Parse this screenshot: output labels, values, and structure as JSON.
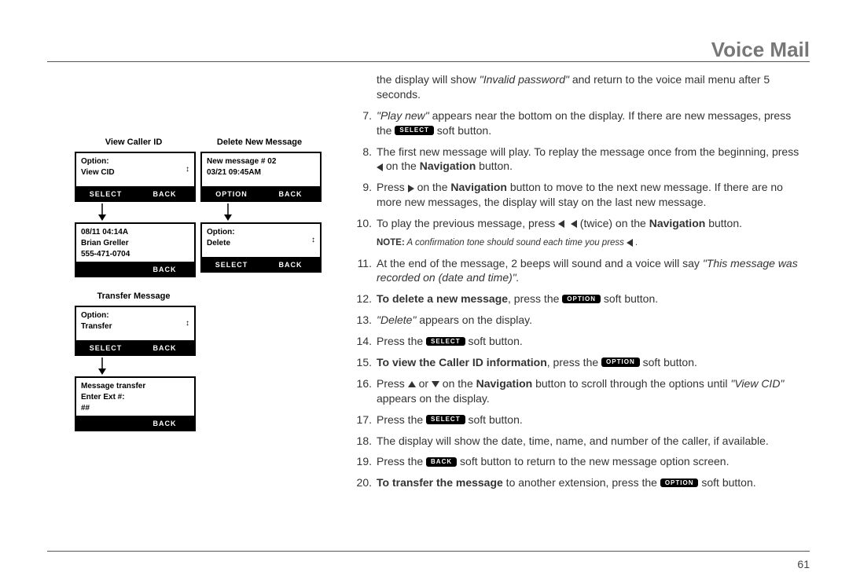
{
  "header": "Voice Mail",
  "pagenum": "61",
  "lcd": {
    "viewCid": {
      "title": "View Caller ID",
      "box1": {
        "line1": "Option:",
        "line2": "View CID",
        "softL": "SELECT",
        "softR": "BACK"
      },
      "box2": {
        "line1": "08/11 04:14A",
        "line2": "Brian Greller",
        "line3": "555-471-0704",
        "softL": "",
        "softR": "BACK"
      }
    },
    "deleteNew": {
      "title": "Delete New Message",
      "box1": {
        "line1": "New message # 02",
        "line2": "03/21 09:45AM",
        "softL": "OPTION",
        "softR": "BACK"
      },
      "box2": {
        "line1": "Option:",
        "line2": "Delete",
        "softL": "SELECT",
        "softR": "BACK"
      }
    },
    "transfer": {
      "title": "Transfer Message",
      "box1": {
        "line1": "Option:",
        "line2": "Transfer",
        "softL": "SELECT",
        "softR": "BACK"
      },
      "box2": {
        "line1": "Message transfer",
        "line2": "Enter Ext #:",
        "line3": "##",
        "softL": "",
        "softR": "BACK"
      }
    }
  },
  "text": {
    "cont": {
      "a": "the display will show ",
      "b": "\"Invalid password\"",
      "c": " and return to the voice mail menu after 5 seconds."
    },
    "s7": {
      "a": "\"Play new\"",
      "b": " appears near the bottom on the display. If there are new messages, press the ",
      "pill": "SELECT",
      "c": " soft button."
    },
    "s8": {
      "a": "The first new message will play. To replay the message once from the beginning, press ",
      "b": " on the ",
      "nav": "Navigation",
      "c": " button."
    },
    "s9": {
      "a": "Press ",
      "b": " on the ",
      "nav": "Navigation",
      "c": " button to move to the next new message. If there are no more new messages, the display will stay on the last new message."
    },
    "s10": {
      "a": "To play the previous message, press ",
      "b": " (twice) on the ",
      "nav": "Navigation",
      "c": " button."
    },
    "note": {
      "label": "NOTE:",
      "body": " A confirmation tone should sound each time you press "
    },
    "s11": {
      "a": "At the end of the message, 2 beeps will sound and a voice will say ",
      "b": "\"This message was recorded on (date and time)\"."
    },
    "s12": {
      "a": "To delete a new message",
      "b": ", press the ",
      "pill": "OPTION",
      "c": " soft button."
    },
    "s13": {
      "a": "\"Delete\"",
      "b": " appears on the display."
    },
    "s14": {
      "a": "Press the ",
      "pill": "SELECT",
      "b": " soft button."
    },
    "s15": {
      "a": "To view the Caller ID information",
      "b": ", press the ",
      "pill": "OPTION",
      "c": " soft button."
    },
    "s16": {
      "a": "Press ",
      "b": " or ",
      "c": " on the ",
      "nav": "Navigation",
      "d": " button to scroll through the options until ",
      "e": "\"View CID\"",
      "f": " appears on the display."
    },
    "s17": {
      "a": "Press the ",
      "pill": "SELECT",
      "b": " soft button."
    },
    "s18": {
      "a": "The display will show the date, time, name, and number of the caller, if available."
    },
    "s19": {
      "a": "Press the ",
      "pill": "BACK",
      "b": " soft button to return to the new message option screen."
    },
    "s20": {
      "a": "To transfer the message",
      "b": " to another extension, press the ",
      "pill": "OPTION",
      "c": " soft button."
    }
  }
}
